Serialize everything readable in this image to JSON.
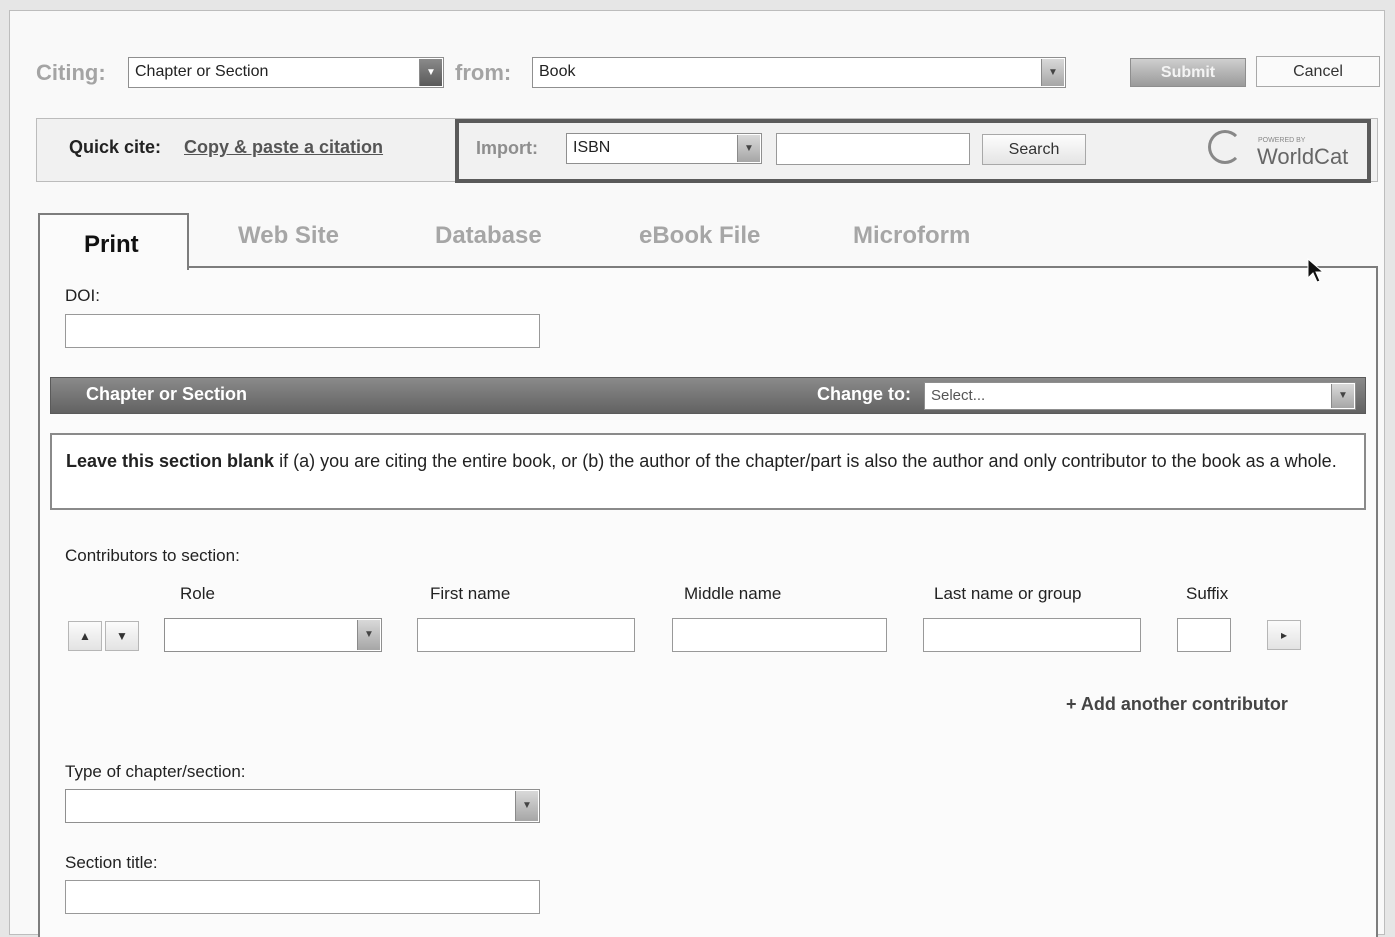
{
  "citing": {
    "label": "Citing:",
    "type_value": "Chapter or Section",
    "from_label": "from:",
    "from_value": "Book",
    "submit_label": "Submit",
    "cancel_label": "Cancel"
  },
  "quick_cite": {
    "label": "Quick cite:",
    "link": "Copy & paste a citation",
    "import_label": "Import:",
    "import_type": "ISBN",
    "import_value": "",
    "search_label": "Search",
    "worldcat_small": "POWERED BY",
    "worldcat_label": "WorldCat"
  },
  "tabs": [
    {
      "label": "Print"
    },
    {
      "label": "Web Site"
    },
    {
      "label": "Database"
    },
    {
      "label": "eBook File"
    },
    {
      "label": "Microform"
    }
  ],
  "doi": {
    "label": "DOI:",
    "value": ""
  },
  "section_bar": {
    "title": "Chapter or Section",
    "change_label": "Change to:",
    "change_placeholder": "Select..."
  },
  "notice": {
    "bold": "Leave this section blank",
    "text": " if (a) you are citing the entire book, or (b) the author of the chapter/part is also the author and only contributor to the book as a whole."
  },
  "contributors": {
    "label": "Contributors to section:",
    "columns": {
      "role": "Role",
      "first": "First name",
      "middle": "Middle name",
      "last": "Last name or group",
      "suffix": "Suffix"
    },
    "up_icon": "▲",
    "down_icon": "▼",
    "remove_icon": "▸",
    "add_label": "+ Add another contributor"
  },
  "type_of_chapter": {
    "label": "Type of chapter/section:",
    "value": ""
  },
  "section_title": {
    "label": "Section title:",
    "value": ""
  },
  "colors": {
    "section_bar": "#707070",
    "import_border": "#5a5a5a",
    "muted_label": "#a4a4a4"
  }
}
